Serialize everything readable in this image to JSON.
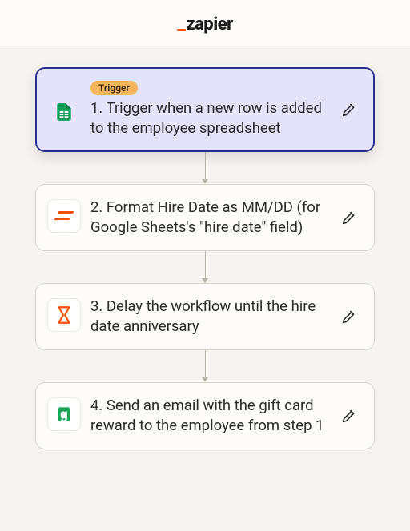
{
  "brand": {
    "name": "zapier"
  },
  "badge": {
    "trigger": "Trigger"
  },
  "steps": [
    {
      "title": "1. Trigger when a new row is added to the employee spreadsheet",
      "app": "google-sheets",
      "is_trigger": true,
      "selected": true
    },
    {
      "title": "2. Format Hire Date as MM/DD (for Google Sheets's \"hire date\" field)",
      "app": "formatter",
      "is_trigger": false,
      "selected": false
    },
    {
      "title": "3. Delay the workflow until the hire date anniversary",
      "app": "delay",
      "is_trigger": false,
      "selected": false
    },
    {
      "title": "4. Send an email with the gift card reward to the employee from step 1",
      "app": "giftcard",
      "is_trigger": false,
      "selected": false
    }
  ]
}
